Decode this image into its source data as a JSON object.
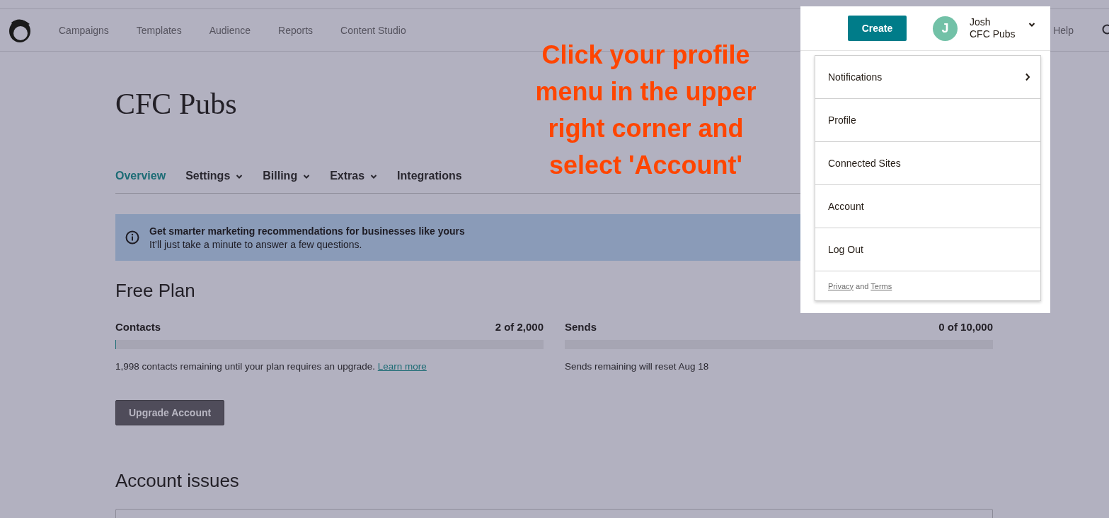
{
  "nav": [
    "Campaigns",
    "Templates",
    "Audience",
    "Reports",
    "Content Studio"
  ],
  "help_link": "Help",
  "profile": {
    "create_button": "Create",
    "avatar_initial": "J",
    "name": "Josh",
    "org": "CFC Pubs"
  },
  "profile_menu": {
    "items": [
      {
        "label": "Notifications",
        "kind": "submenu"
      },
      {
        "label": "Profile",
        "kind": "link"
      },
      {
        "label": "Connected Sites",
        "kind": "link"
      },
      {
        "label": "Account",
        "kind": "link"
      },
      {
        "label": "Log Out",
        "kind": "link"
      }
    ],
    "footer": {
      "privacy_link": "Privacy",
      "joiner": "and",
      "terms_link": "Terms"
    }
  },
  "annotation": {
    "lines": [
      "Click your profile",
      "menu in the upper",
      "right corner and",
      "select 'Account'"
    ]
  },
  "title": "CFC Pubs",
  "tabs": [
    {
      "label": "Overview",
      "selected": true,
      "has_menu": false
    },
    {
      "label": "Settings",
      "selected": false,
      "has_menu": true
    },
    {
      "label": "Billing",
      "selected": false,
      "has_menu": true
    },
    {
      "label": "Extras",
      "selected": false,
      "has_menu": true
    },
    {
      "label": "Integrations",
      "selected": false,
      "has_menu": false
    }
  ],
  "banner": {
    "title": "Get smarter marketing recommendations for businesses like yours",
    "text": "It’ll just take a minute to answer a few questions."
  },
  "plan": {
    "heading": "Free Plan",
    "meters": [
      {
        "label": "Contacts",
        "reading": "2 of 2,000",
        "level": 0.001,
        "note": "1,998 contacts remaining until your plan requires an upgrade.",
        "link": "Learn more"
      },
      {
        "label": "Sends",
        "reading": "0 of 10,000",
        "level": 0,
        "note": "Sends remaining will reset Aug 18"
      }
    ]
  },
  "upgrade_button": "Upgrade Account",
  "issues_heading": "Account issues"
}
